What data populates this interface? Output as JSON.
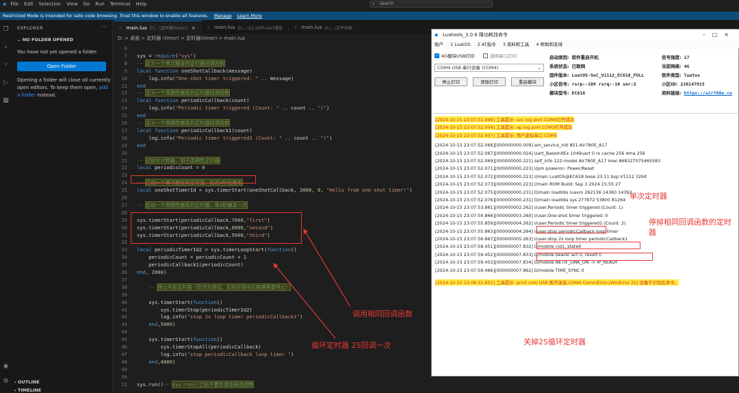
{
  "menubar": {
    "items": [
      "File",
      "Edit",
      "Selection",
      "View",
      "Go",
      "Run",
      "Terminal",
      "Help"
    ],
    "search": "Search"
  },
  "restricted": {
    "text": "Restricted Mode is intended for safe code browsing. Trust this window to enable all features.",
    "manage": "Manage",
    "learn": "Learn More"
  },
  "sidebar": {
    "title": "EXPLORER",
    "section": "NO FOLDER OPENED",
    "msg1": "You have not yet opened a folder.",
    "open_button": "Open Folder",
    "msg2a": "Opening a folder will close all currently open editors. To keep them open, ",
    "msg2link": "add a folder",
    "msg2b": " instead.",
    "outline": "OUTLINE",
    "timeline": "TIMELINE"
  },
  "tabs": [
    {
      "name": "main.lua",
      "path": "D:\\...\\定时器(timer)"
    },
    {
      "name": "main.lua",
      "path": "D:\\...\\12.UDP-Uart通信"
    },
    {
      "name": "main.lua",
      "path": "D:\\...\\文件系统"
    }
  ],
  "breadcrumb": "D: > 桌面 > 定时器 (timer) > 定时器(timer) > main.lua",
  "code_lines": [
    {
      "n": "6",
      "t": ""
    },
    {
      "n": "7",
      "t": "sys = require(\"sys\")"
    },
    {
      "n": "8",
      "t": "-- 定义一个单次触发的定时器回调函数"
    },
    {
      "n": "9",
      "t": "local function oneShotCallback(message)"
    },
    {
      "n": "10",
      "t": "    log.info(\"One-shot timer triggered: \" .. message)"
    },
    {
      "n": "11",
      "t": "end"
    },
    {
      "n": "12",
      "t": "-- 定义一个周期性触发的定时器回调函数"
    },
    {
      "n": "13",
      "t": "local function periodicCallback(count)"
    },
    {
      "n": "14",
      "t": "    log.info(\"Periodic timer triggered (Count: \" .. count .. \")\")"
    },
    {
      "n": "15",
      "t": "end"
    },
    {
      "n": "16",
      "t": "-- 定义一个周期性触发的定时器回调函数"
    },
    {
      "n": "17",
      "t": "local function periodicCallback1(count)"
    },
    {
      "n": "18",
      "t": "    log.info(\"Periodic timer triggered1 (Count: \" .. count .. \")\")"
    },
    {
      "n": "19",
      "t": "end"
    },
    {
      "n": "20",
      "t": ""
    },
    {
      "n": "21",
      "t": "-- 初始化计数器，用于周期性定时器"
    },
    {
      "n": "22",
      "t": "local periodicCount = 0"
    },
    {
      "n": "23",
      "t": ""
    },
    {
      "n": "24",
      "t": "-- 启动一个单次触发的定时器，延迟3秒后触发"
    },
    {
      "n": "25",
      "t": "local oneShotTimerId = sys.timerStart(oneShotCallback, 3000, 0, \"Hello from one-shot timer!\")"
    },
    {
      "n": "26",
      "t": ""
    },
    {
      "n": "27",
      "t": "-- 启动一个周期性触发的定时器，每2秒触发一次"
    },
    {
      "n": "28",
      "t": ""
    },
    {
      "n": "29",
      "t": "sys.timerStart(periodicCallback,7000,\"first\")"
    },
    {
      "n": "30",
      "t": "sys.timerStart(periodicCallback,6000,\"second\")"
    },
    {
      "n": "31",
      "t": "sys.timerStart(periodicCallback,5000,\"third\")"
    },
    {
      "n": "32",
      "t": ""
    },
    {
      "n": "33",
      "t": "local periodicTimerId2 = sys.timerLoopStart(function()"
    },
    {
      "n": "34",
      "t": "    periodicCount = periodicCount + 1"
    },
    {
      "n": "35",
      "t": "    periodicCallback1(periodicCount)"
    },
    {
      "n": "36",
      "t": "end, 2000)"
    },
    {
      "n": "37",
      "t": ""
    },
    {
      "n": "38",
      "t": "    -- 停止所有定时器（仅作为测试，实际应用中应根据需要停止）"
    },
    {
      "n": "39",
      "t": ""
    },
    {
      "n": "40",
      "t": "    sys.timerStart(function()"
    },
    {
      "n": "41",
      "t": "        sys.timerStop(periodicTimerId2)"
    },
    {
      "n": "42",
      "t": "        log.info(\"stop 2s loop timer periodicCallback1\")"
    },
    {
      "n": "43",
      "t": "    end,5000)"
    },
    {
      "n": "44",
      "t": ""
    },
    {
      "n": "45",
      "t": "    sys.timerStart(function()"
    },
    {
      "n": "46",
      "t": "        sys.timerStopAll(periodicCallback)"
    },
    {
      "n": "47",
      "t": "        log.info(\"stop periodicCallback loop timer \")"
    },
    {
      "n": "48",
      "t": "    end,4000)"
    },
    {
      "n": "49",
      "t": ""
    },
    {
      "n": "50",
      "t": ""
    },
    {
      "n": "51",
      "t": "sys.run()-- sys.run()之后不要在添加其他函数"
    }
  ],
  "annotations": {
    "same_callback": "调用相同回调函数",
    "loop_timer": "循环定时器 2S回调一次",
    "one_shot": "单次定时器",
    "stop_same": "停掉相同回调函数的定时器",
    "stop_2s": "关掉2S循环定时器"
  },
  "luatools": {
    "title": "Luatools_3.0.6 降功耗找命令",
    "menu": [
      "账户",
      "1 LuatOS",
      "2 AT指令",
      "3 资料和工具",
      "4 帮助和支持"
    ],
    "cb_usb": "4G模块USB打印",
    "cb_uart": "通用串口打印",
    "select": "COM4 USB 串行设备 (COM4)",
    "btn_stop": "停止打印",
    "btn_clear": "清除打印",
    "btn_restart": "重启模块",
    "info": {
      "k1": "启动原因:",
      "v1": "软件重启开机",
      "k2": "系统状态:",
      "v2": "已联网",
      "k3": "固件版本:",
      "v3": "LuatOS-SoC_V1112_EC618_FULL",
      "k4": "小区信号:",
      "v4": "rsrp:-109 rsrq:-10 snr:3",
      "k5": "模块型号:",
      "v5": "EC618",
      "k6": "信号强度:",
      "v6": "17",
      "k7": "当前网络:",
      "v7": "4G",
      "k8": "软件类型:",
      "v8": "luatos",
      "k9": "小区ID:",
      "v9": "228147915",
      "k10": "资料链接:",
      "v10": "https://air780e.cn"
    },
    "log": [
      "[2024-10-15 23:07:51.968] 工具提示: soc log port COM4打开成功",
      "[2024-10-15 23:07:52.004] 工具提示: ap log port COM3打开成功",
      "[2024-10-15 23:07:52.007] 工具提示: 用户虚拟串口 COM5",
      "[2024-10-15 23:07:52.066][000000000.009] am_service_init 851:Air780E_A17",
      "[2024-10-15 23:07:52.067][000000000.024] Uart_BaseInitEx 1049uart 0 rx cache 256 dma 256",
      "[2024-10-15 23:07:52.069][000000000.221] self_info 122:model Air780E_A17 imei 868327075465583",
      "[2024-10-15 23:07:52.071][000000000.223] I/pm poweron: Power/Reset",
      "[2024-10-15 23:07:52.072][000000000.223] I/main LuatOS@EC618 base 23.11 bsp V1112 32bit",
      "[2024-10-15 23:07:52.073][000000000.223] I/main ROM Build: Sep  3 2024 15:55:27",
      "[2024-10-15 23:07:52.075][000000000.231] D/main loadlibs luavm 262136 14360 14392",
      "[2024-10-15 23:07:52.076][000000000.231] D/main loadlibs sys   277872 53800 81264",
      "[2024-10-15 23:07:53.861][000000002.262] I/user.Periodic timer triggered (Count: 1)",
      "[2024-10-15 23:07:54.866][000000003.260] I/user.One-shot timer triggered: 0",
      "[2024-10-15 23:07:55.859][000000004.262] I/user.Periodic timer triggered1 (Count: 2)",
      "[2024-10-15 23:07:55.863][000000004.264] I/user.stop periodicCallback loop timer",
      "[2024-10-15 23:07:56.867][000000005.263] I/user.stop 2s loop timer periodicCallback1",
      "[2024-10-15 23:07:59.451][000000007.832] D/mobile cid1, state0",
      "[2024-10-15 23:07:59.452][000000007.833] D/mobile bearer act 0, result 0",
      "[2024-10-15 23:07:59.453][000000007.834] D/mobile NETIF_LINK_ON -> IP_READY",
      "[2024-10-15 23:07:59.466][000000007.862] D/mobile TIME_SYNC 0",
      "[2024-10-15 23:08:31.652] 工具提示: print com USB 断开连接,COM4 CommError,[WinError 22] 设备不识别此命令。"
    ]
  }
}
